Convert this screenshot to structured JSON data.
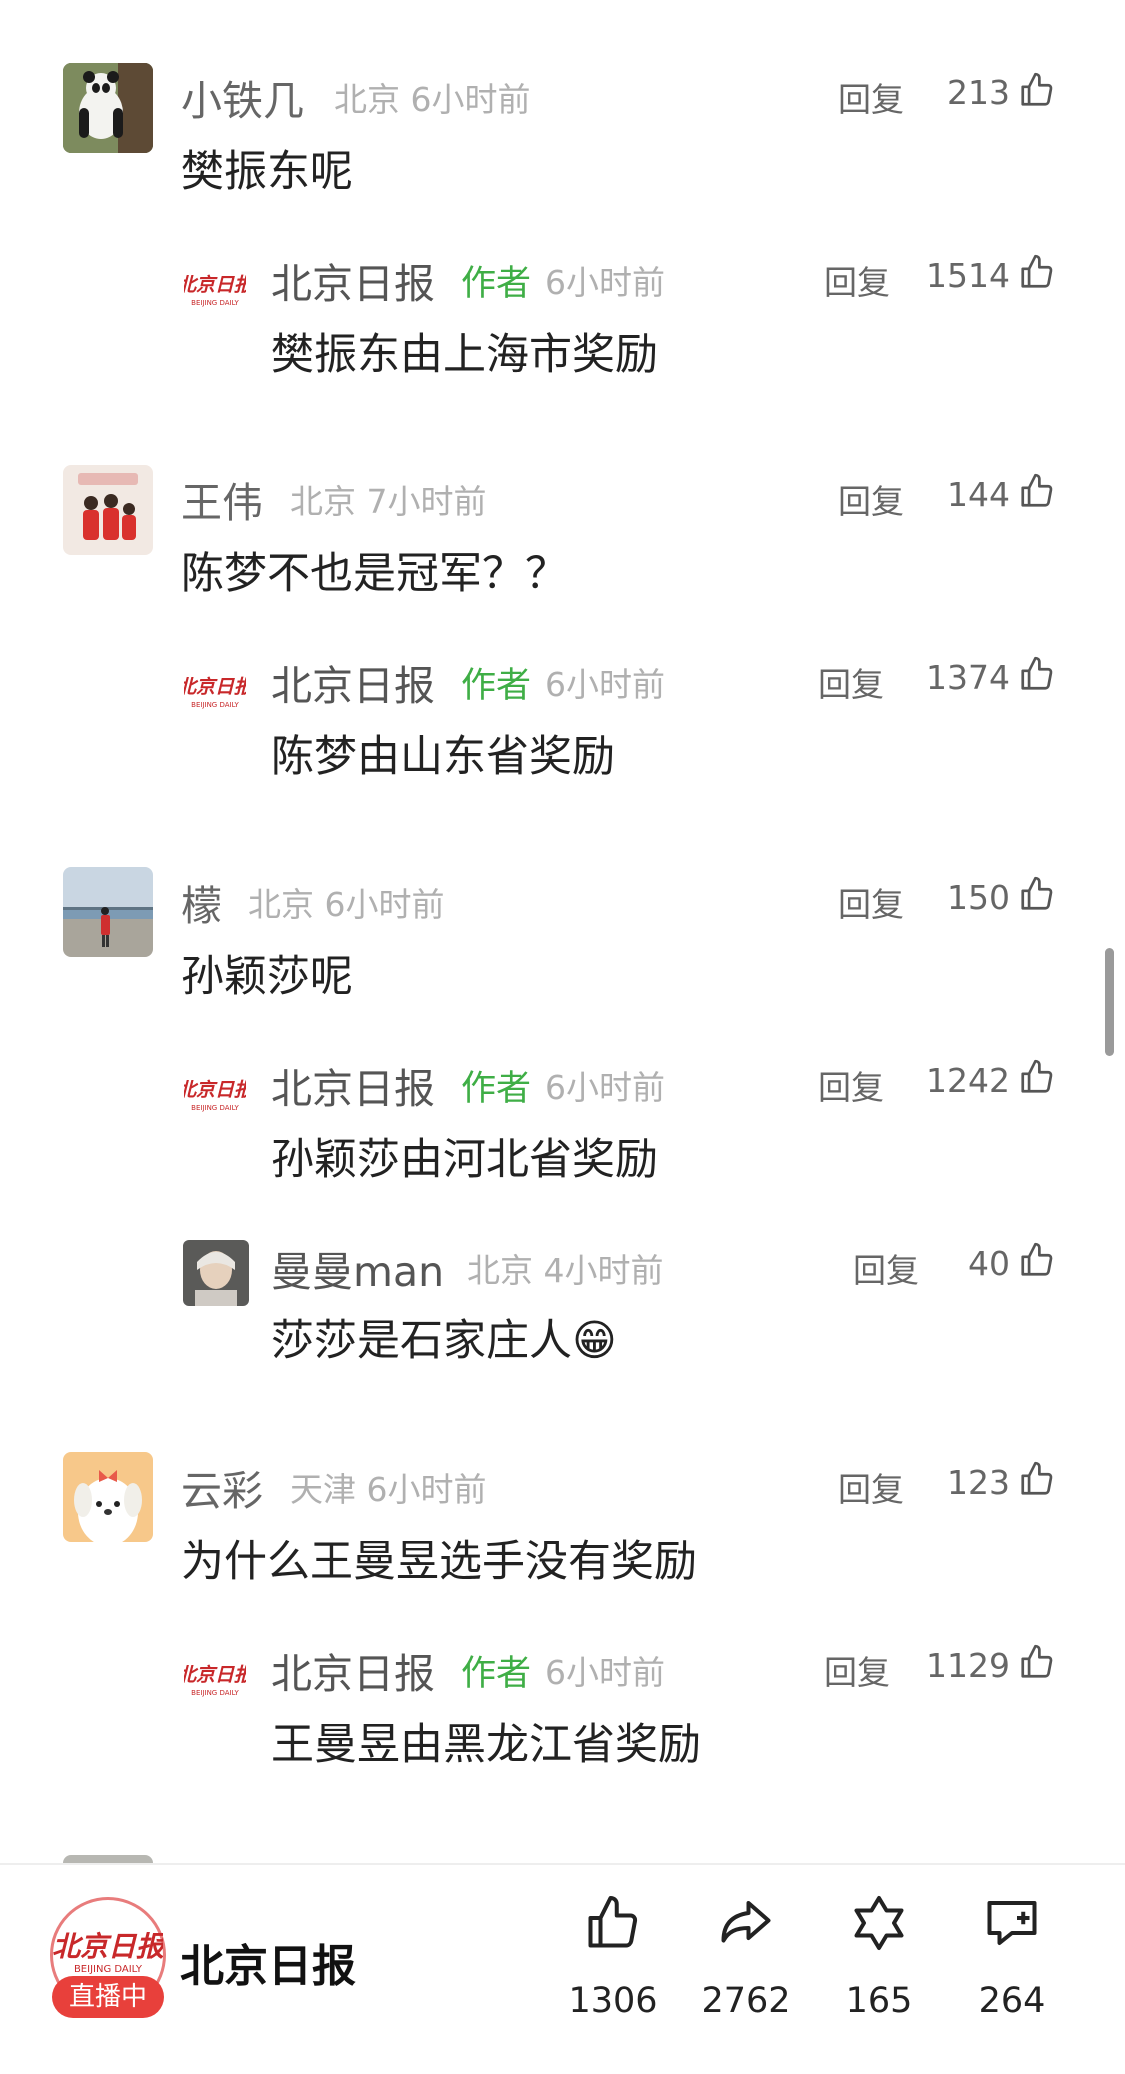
{
  "comments": [
    {
      "name": "小铁几",
      "meta": "北京 6小时前",
      "reply_label": "回复",
      "likes": "213",
      "content": "樊振东呢",
      "avatar_icon": "panda-avatar"
    },
    {
      "name": "北京日报",
      "author_tag": "作者",
      "meta": "6小时前",
      "reply_label": "回复",
      "likes": "1514",
      "content": "樊振东由上海市奖励"
    },
    {
      "name": "王伟",
      "meta": "北京 7小时前",
      "reply_label": "回复",
      "likes": "144",
      "content": "陈梦不也是冠军？？",
      "avatar_icon": "family-photo-avatar"
    },
    {
      "name": "北京日报",
      "author_tag": "作者",
      "meta": "6小时前",
      "reply_label": "回复",
      "likes": "1374",
      "content": "陈梦由山东省奖励"
    },
    {
      "name": "檬",
      "meta": "北京 6小时前",
      "reply_label": "回复",
      "likes": "150",
      "content": "孙颖莎呢",
      "avatar_icon": "seaside-photo-avatar"
    },
    {
      "name": "北京日报",
      "author_tag": "作者",
      "meta": "6小时前",
      "reply_label": "回复",
      "likes": "1242",
      "content": "孙颖莎由河北省奖励"
    },
    {
      "name": "曼曼man",
      "meta": "北京 4小时前",
      "reply_label": "回复",
      "likes": "40",
      "content": "莎莎是石家庄人",
      "avatar_icon": "portrait-avatar",
      "emoji": "😁"
    },
    {
      "name": "云彩",
      "meta": "天津 6小时前",
      "reply_label": "回复",
      "likes": "123",
      "content": "为什么王曼昱选手没有奖励",
      "avatar_icon": "cartoon-dog-avatar"
    },
    {
      "name": "北京日报",
      "author_tag": "作者",
      "meta": "6小时前",
      "reply_label": "回复",
      "likes": "1129",
      "content": "王曼昱由黑龙江省奖励"
    }
  ],
  "footer": {
    "channel_name": "北京日报",
    "logo_text": "北京日报",
    "logo_subtext": "BEIJING DAILY",
    "live_badge": "直播中",
    "like_count": "1306",
    "share_count": "2762",
    "collect_count": "165",
    "comment_count": "264"
  },
  "colors": {
    "author_green": "#3fae46",
    "live_red": "#e8403b",
    "logo_red": "#c8282a"
  }
}
